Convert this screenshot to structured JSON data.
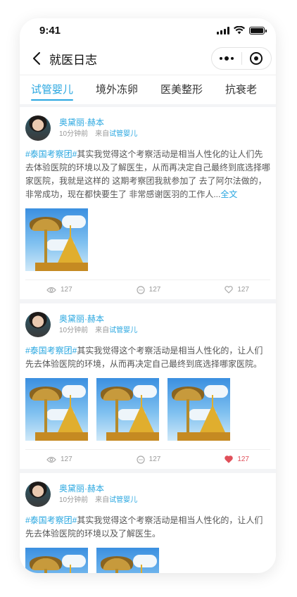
{
  "status": {
    "time": "9:41"
  },
  "nav": {
    "title": "就医日志"
  },
  "tabs": [
    {
      "label": "试管婴儿",
      "active": true
    },
    {
      "label": "境外冻卵"
    },
    {
      "label": "医美整形"
    },
    {
      "label": "抗衰老"
    }
  ],
  "posts": [
    {
      "author": "奥黛丽·赫本",
      "time": "10分钟前",
      "from_label": "来自",
      "source": "试管婴儿",
      "tag": "#泰国考察团#",
      "body": "其实我觉得这个考察活动是相当人性化的让人们先去体验医院的环境以及了解医生，从而再决定自己最终到底选择哪家医院，我就是这样的 这期考察团我就参加了 去了阿尔法做的，非常成功，现在都快要生了 非常感谢医羽的工作人...",
      "more": "全文",
      "views": "127",
      "comments": "127",
      "likes": "127",
      "liked": false
    },
    {
      "author": "奥黛丽·赫本",
      "time": "10分钟前",
      "from_label": "来自",
      "source": "试管婴儿",
      "tag": "#泰国考察团#",
      "body": "其实我觉得这个考察活动是相当人性化的，让人们先去体验医院的环境，从而再决定自己最终到底选择哪家医院。",
      "more": "",
      "views": "127",
      "comments": "127",
      "likes": "127",
      "liked": true
    },
    {
      "author": "奥黛丽·赫本",
      "time": "10分钟前",
      "from_label": "来自",
      "source": "试管婴儿",
      "tag": "#泰国考察团#",
      "body": "其实我觉得这个考察活动是相当人性化的，让人们先去体验医院的环境以及了解医生。",
      "more": ""
    }
  ],
  "colors": {
    "accent": "#2aa7e0",
    "liked": "#e0505a"
  },
  "icons": [
    "back-arrow-icon",
    "more-dots-icon",
    "close-target-icon",
    "eye-icon",
    "comment-icon",
    "heart-icon"
  ]
}
